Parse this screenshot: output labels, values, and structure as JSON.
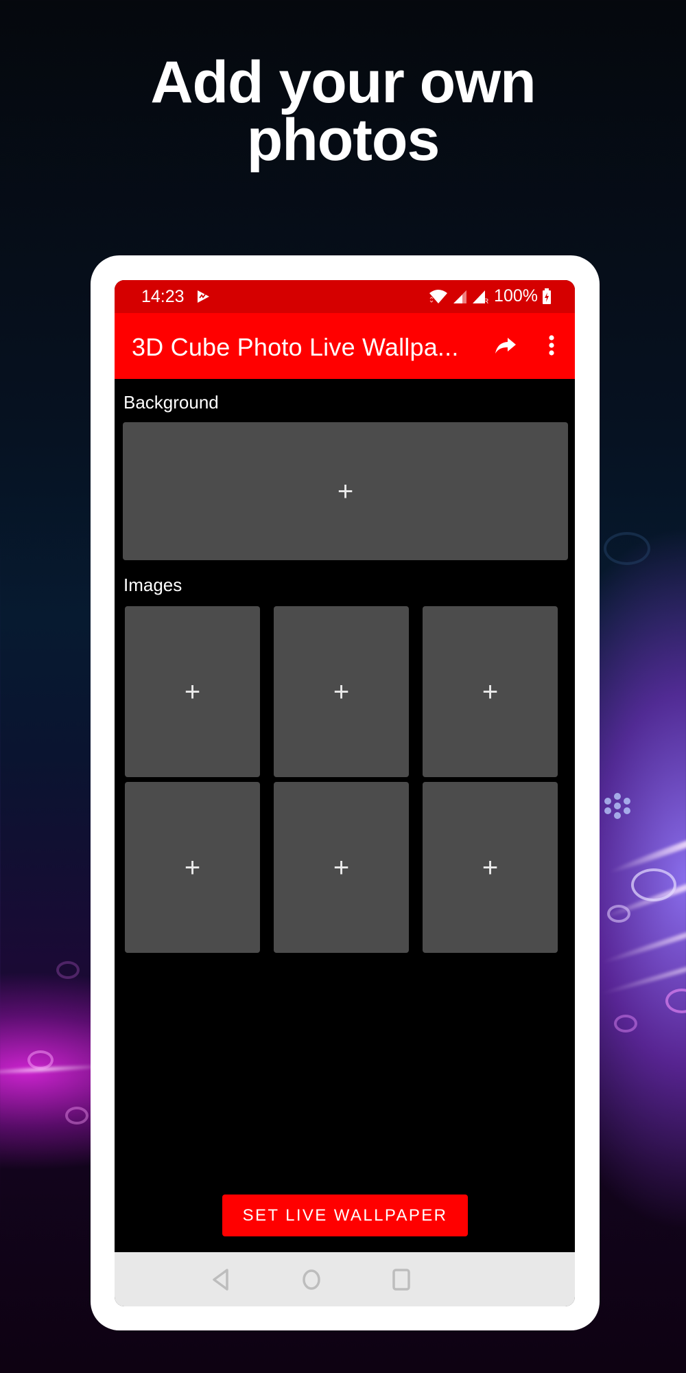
{
  "headline": {
    "line1": "Add your own",
    "line2": "photos"
  },
  "status_bar": {
    "time": "14:23",
    "notification_icon": "play-store-icon",
    "wifi_icon": "wifi-icon",
    "signal_icons": [
      "signal-icon",
      "signal-roaming-icon"
    ],
    "roaming_label": "R",
    "battery_percent": "100%",
    "battery_icon": "battery-charging-icon"
  },
  "app_bar": {
    "title": "3D Cube Photo Live Wallpa...",
    "share_icon": "share-icon",
    "menu_icon": "more-vert-icon"
  },
  "content": {
    "background_label": "Background",
    "background_slot": {
      "icon": "plus-icon",
      "glyph": "+"
    },
    "images_label": "Images",
    "image_slots": [
      {
        "glyph": "+"
      },
      {
        "glyph": "+"
      },
      {
        "glyph": "+"
      },
      {
        "glyph": "+"
      },
      {
        "glyph": "+"
      },
      {
        "glyph": "+"
      }
    ],
    "set_button_label": "SET LIVE WALLPAPER"
  },
  "nav_bar": {
    "back": "back-icon",
    "home": "home-icon",
    "recents": "recents-icon"
  },
  "colors": {
    "status_bar": "#d50000",
    "app_bar": "#ff0000",
    "accent_button": "#ff0000",
    "slot_fill": "#4c4c4c",
    "screen_bg": "#000000",
    "nav_bar": "#e8e8e8",
    "frame": "#ffffff"
  }
}
